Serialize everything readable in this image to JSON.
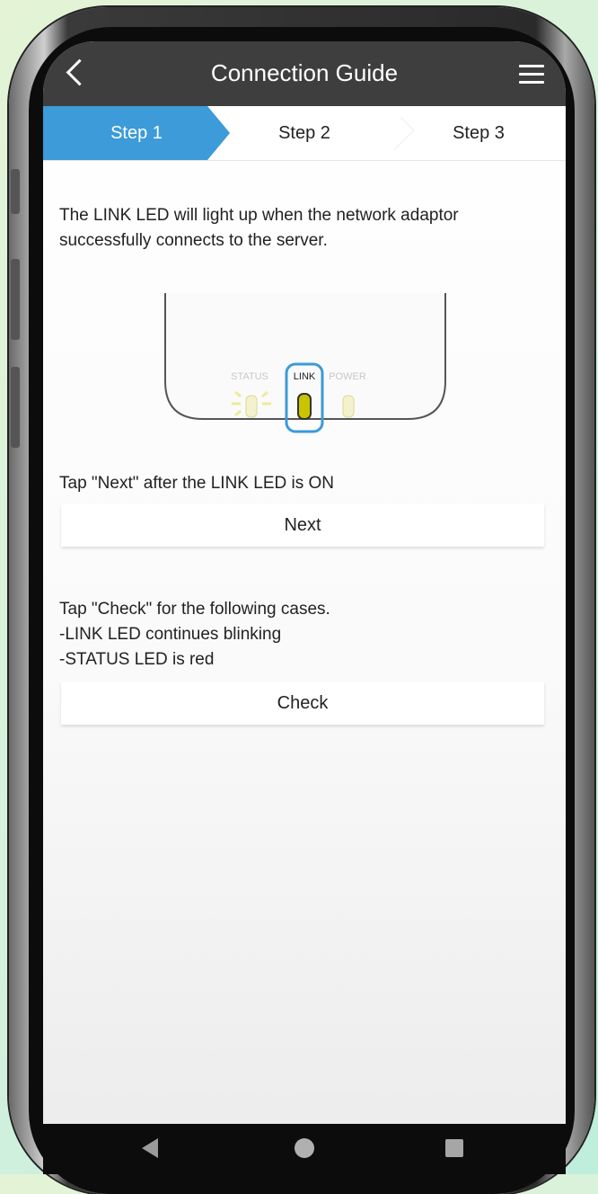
{
  "header": {
    "title": "Connection Guide",
    "back_icon": "chevron-left-icon",
    "menu_icon": "hamburger-menu-icon"
  },
  "steps": [
    {
      "label": "Step 1",
      "active": true
    },
    {
      "label": "Step 2",
      "active": false
    },
    {
      "label": "Step 3",
      "active": false
    }
  ],
  "main": {
    "intro": "The LINK LED will light up when the network adaptor successfully connects to the server.",
    "illustration": {
      "status_label": "STATUS",
      "link_label": "LINK",
      "power_label": "POWER"
    },
    "next_hint": "Tap \"Next\" after the LINK LED is ON",
    "next_button": "Next",
    "check_hint_1": "Tap \"Check\" for the following cases.",
    "check_hint_2": "-LINK LED continues blinking",
    "check_hint_3": "-STATUS LED is red",
    "check_button": "Check"
  },
  "colors": {
    "header_bg": "#3e3e3e",
    "step_active": "#3c9bd8",
    "led_link": "#c9c400",
    "highlight": "#3c9bd8"
  }
}
